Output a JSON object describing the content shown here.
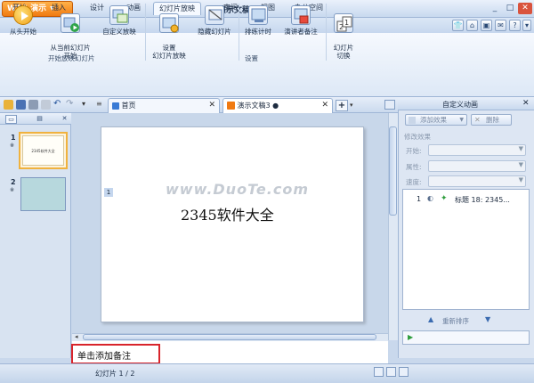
{
  "app": {
    "logo_text": "WPS 演示",
    "doc_title": "演示文稿3 ●"
  },
  "tabs": [
    "开始",
    "插入",
    "设计",
    "动画",
    "幻灯片放映",
    "审阅",
    "视图",
    "办公空间"
  ],
  "active_tab": "幻灯片放映",
  "ribbon": {
    "groups": [
      {
        "label": "开始放映幻灯片",
        "buttons": [
          {
            "id": "from-start",
            "label": "从头开始",
            "icon": "play-icon"
          },
          {
            "id": "from-current",
            "label": "从当前幻灯片\n开始",
            "icon": "play-from-current-icon"
          },
          {
            "id": "custom-show",
            "label": "自定义放映",
            "icon": "custom-show-icon"
          }
        ]
      },
      {
        "label": "设置",
        "buttons": [
          {
            "id": "setup-show",
            "label": "设置\n幻灯片放映",
            "icon": "setup-show-icon"
          },
          {
            "id": "hide-slide",
            "label": "隐藏幻灯片",
            "icon": "hide-slide-icon"
          },
          {
            "id": "rehearse",
            "label": "排练计时",
            "icon": "timer-icon"
          },
          {
            "id": "speaker-notes",
            "label": "演讲者备注",
            "icon": "notes-icon"
          }
        ]
      },
      {
        "label": "",
        "buttons": [
          {
            "id": "slide-switch",
            "label": "幻灯片\n切换",
            "icon": "slide-switch-icon"
          }
        ]
      }
    ]
  },
  "doc_tabs": [
    {
      "label": "首页",
      "closable": true
    },
    {
      "label": "演示文稿3 ●",
      "closable": true,
      "active": true
    }
  ],
  "slides": [
    {
      "number": "1",
      "thumb_text": "2345软件大全",
      "selected": true
    },
    {
      "number": "2",
      "thumb_text": "",
      "selected": false
    }
  ],
  "current_slide": {
    "marker": "1",
    "text": "2345软件大全"
  },
  "watermark": "www.DuoTe.com",
  "notes_placeholder": "单击添加备注",
  "right_pane": {
    "title": "自定义动画",
    "add_effect": "添加效果",
    "delete": "删除",
    "modify_label": "修改效果",
    "fields": [
      "开始:",
      "属性:",
      "速度:"
    ],
    "animation_items": [
      {
        "index": "1",
        "label": "标题 18: 2345..."
      }
    ],
    "reorder_label": "重新排序"
  },
  "status": {
    "slide_count": "幻灯片 1 / 2"
  },
  "colors": {
    "accent": "#f07a12",
    "highlight_box": "#d8242b",
    "chrome": "#c9d8ec"
  }
}
